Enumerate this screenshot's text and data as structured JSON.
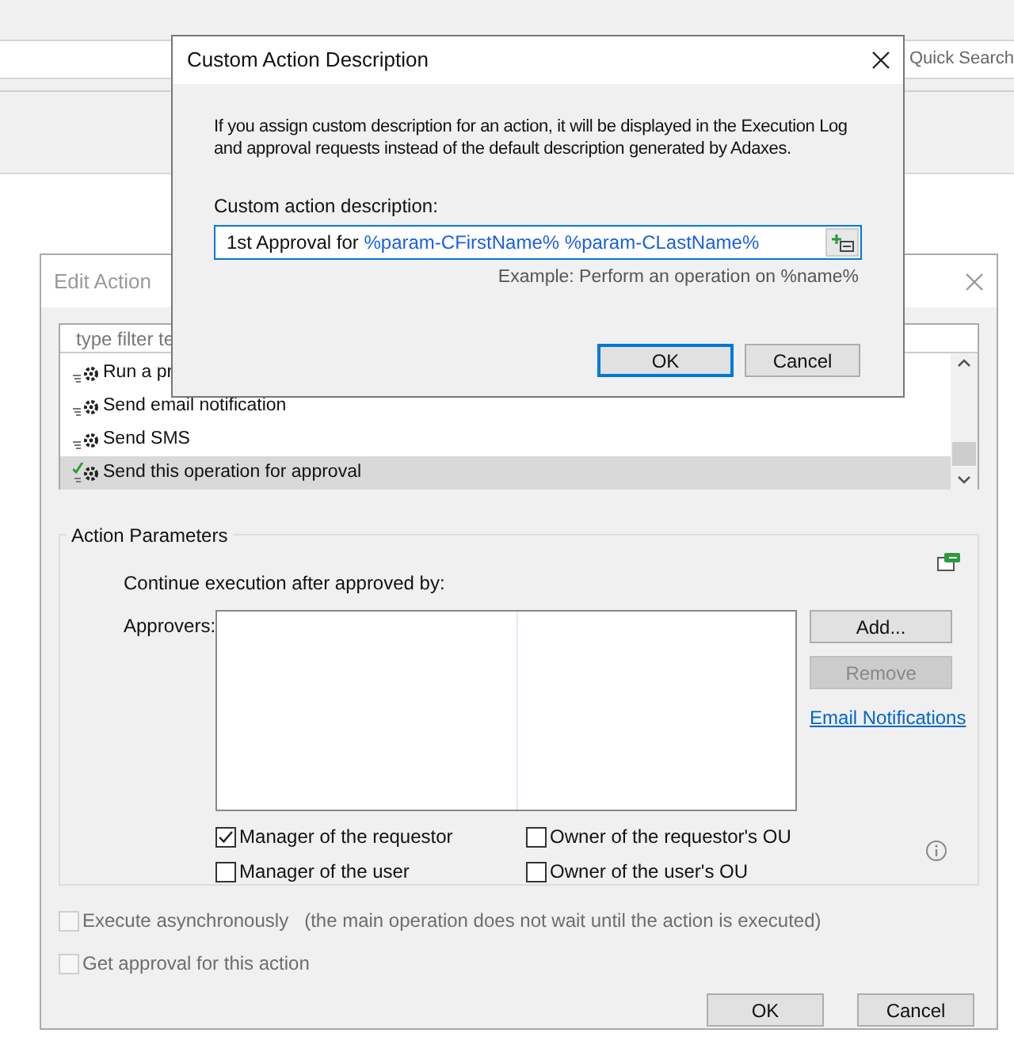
{
  "app": {
    "search_placeholder": "Quick Search"
  },
  "edit_action": {
    "title": "Edit Action",
    "filter_placeholder": "type filter te",
    "actions": [
      {
        "label": "Run a pr",
        "selected": false
      },
      {
        "label": "Send email notification",
        "selected": false
      },
      {
        "label": "Send SMS",
        "selected": false
      },
      {
        "label": "Send this operation for approval",
        "selected": true
      }
    ],
    "parameters": {
      "title": "Action Parameters",
      "continue_label": "Continue execution after approved by:",
      "approvers_label": "Approvers:",
      "buttons": [
        {
          "label": "Add...",
          "disabled": false
        },
        {
          "label": "Remove",
          "disabled": true
        }
      ],
      "link": "Email Notifications",
      "checkboxes": [
        {
          "label": "Manager of the requestor",
          "checked": true
        },
        {
          "label": "Owner of the requestor's OU",
          "checked": false
        },
        {
          "label": "Manager of the user",
          "checked": false
        },
        {
          "label": "Owner of the user's OU",
          "checked": false
        }
      ]
    },
    "options": [
      {
        "label": "Execute asynchronously",
        "note": "(the main operation does not wait until the action is executed)",
        "checked": false,
        "disabled": true
      },
      {
        "label": "Get approval for this action",
        "checked": false,
        "disabled": true
      }
    ],
    "buttons": [
      "OK",
      "Cancel"
    ]
  },
  "dialog": {
    "title": "Custom Action Description",
    "description": "If you assign custom description for an action, it will be displayed in the Execution Log and approval requests instead of the default description generated by Adaxes.",
    "field_label": "Custom action description:",
    "field_value": [
      {
        "text": "1st Approval for ",
        "kind": "plain"
      },
      {
        "text": "%param-CFirstName% %param-CLastName%",
        "kind": "variable"
      }
    ],
    "example": "Example: Perform an operation on %name%",
    "buttons": [
      {
        "label": "OK",
        "default": true
      },
      {
        "label": "Cancel",
        "default": false
      }
    ]
  }
}
